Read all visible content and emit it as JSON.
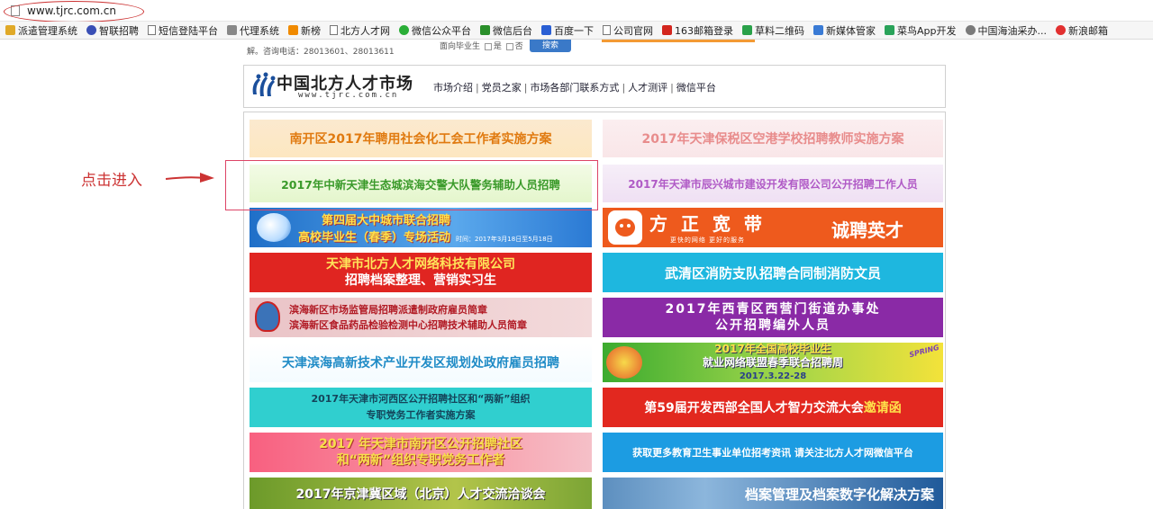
{
  "browser": {
    "url": "www.tjrc.com.cn"
  },
  "bookmarks": [
    {
      "label": "派遣管理系统",
      "icon": "folder-icon"
    },
    {
      "label": "智联招聘",
      "icon": "globe-icon"
    },
    {
      "label": "短信登陆平台",
      "icon": "page-icon"
    },
    {
      "label": "代理系统",
      "icon": "loading-icon"
    },
    {
      "label": "新榜",
      "icon": "bang-icon"
    },
    {
      "label": "北方人才网",
      "icon": "page-icon"
    },
    {
      "label": "微信公众平台",
      "icon": "wechat-icon"
    },
    {
      "label": "微信后台",
      "icon": "leaf-icon"
    },
    {
      "label": "百度一下",
      "icon": "paw-icon"
    },
    {
      "label": "公司官网",
      "icon": "page-icon"
    },
    {
      "label": "163邮箱登录",
      "icon": "163-icon"
    },
    {
      "label": "草料二维码",
      "icon": "grid-icon"
    },
    {
      "label": "新媒体管家",
      "icon": "p-icon"
    },
    {
      "label": "菜鸟App开发",
      "icon": "bird-icon"
    },
    {
      "label": "中国海油采办...",
      "icon": "oil-icon"
    },
    {
      "label": "新浪邮箱",
      "icon": "sina-icon"
    }
  ],
  "topstrip": {
    "consult": "解。咨询电话：28013601、28013611",
    "grad_question": "面向毕业生",
    "yes": "是",
    "no": "否",
    "search": "搜索"
  },
  "logo": {
    "title": "中国北方人才市场",
    "url": "www.tjrc.com.cn"
  },
  "nav": [
    "市场介绍",
    "党员之家",
    "市场各部门联系方式",
    "人才测评",
    "微信平台"
  ],
  "annotation": "点击进入",
  "tiles": {
    "nk": "南开区2017年聘用社会化工会工作者实施方案",
    "bs": "2017年天津保税区空港学校招聘教师实施方案",
    "zx": "2017年中新天津生态城滨海交警大队警务辅助人员招聘",
    "cx": "2017年天津市辰兴城市建设开发有限公司公开招聘工作人员",
    "job_fair_1": "第四届大中城市联合招聘",
    "job_fair_2": "高校毕业生（春季）专场活动",
    "job_fair_time": "时间：2017年3月18日至5月18日",
    "fz_1": "方 正 宽 带",
    "fz_2": "诚聘英才",
    "fz_3": "更快的网络  更好的服务",
    "bf_1": "天津市北方人才网络科技有限公司",
    "bf_2": "招聘档案整理、营销实习生",
    "wq": "武清区消防支队招聘合同制消防文员",
    "bh_1": "滨海新区市场监管局招聘派遣制政府雇员简章",
    "bh_2": "滨海新区食品药品检验检测中心招聘技术辅助人员简章",
    "xq_1": "2017年西青区西营门街道办事处",
    "xq_2": "公开招聘编外人员",
    "gx": "天津滨海高新技术产业开发区规划处政府雇员招聘",
    "gg_1": "2017年全国高校毕业生",
    "gg_2": "就业网络联盟春季联合招聘周",
    "gg_3": "2017.3.22-28",
    "gg_spring": "SPRING",
    "hx_1": "2017年天津市河西区公开招聘社区和“两新”组织",
    "hx_2": "专职党务工作者实施方案",
    "xb": "第59届开发西部全国人才智力交流大会",
    "xb_hl": "邀请函",
    "nk2_1": "2017 年天津市南开区公开招聘社区",
    "nk2_2": "和“两新”组织专职党务工作者",
    "wx": "获取更多教育卫生事业单位招考资讯 请关注北方人才网微信平台",
    "jjj": "2017年京津冀区域（北京）人才交流洽谈会",
    "da": "档案管理及档案数字化解决方案"
  }
}
